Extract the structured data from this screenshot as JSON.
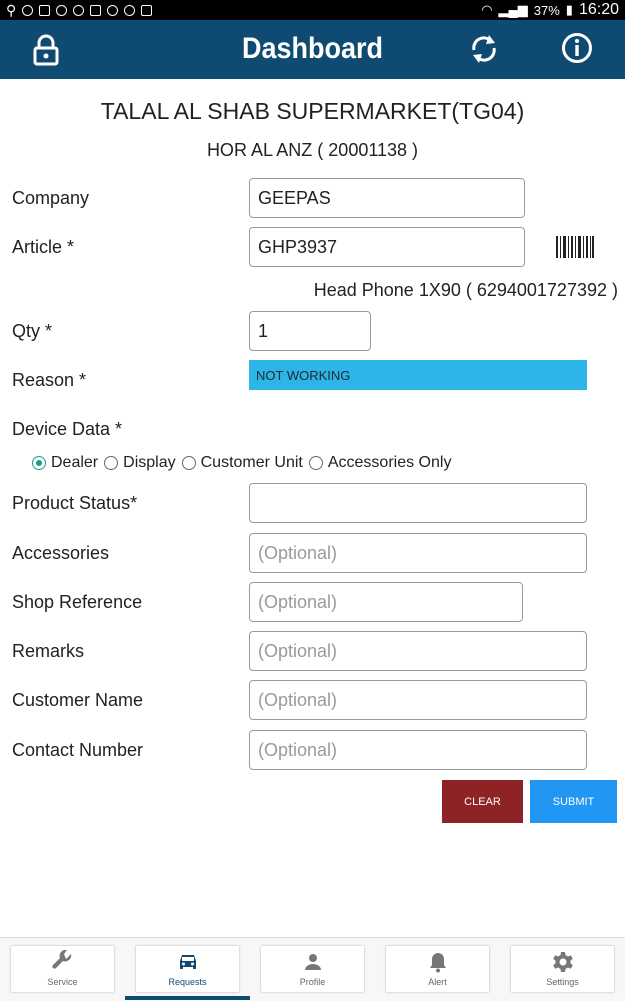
{
  "status_bar": {
    "battery": "37%",
    "time": "16:20"
  },
  "app_bar": {
    "title": "Dashboard"
  },
  "store": {
    "name": "TALAL AL SHAB SUPERMARKET(TG04)",
    "location": "HOR AL ANZ ( 20001138 )"
  },
  "form": {
    "company": {
      "label": "Company",
      "value": "GEEPAS"
    },
    "article": {
      "label": "Article *",
      "value": "GHP3937",
      "description": "Head Phone 1X90 ( 6294001727392 )"
    },
    "qty": {
      "label": "Qty *",
      "value": "1"
    },
    "reason": {
      "label": "Reason *",
      "value": "NOT WORKING"
    },
    "device_data": {
      "label": "Device Data *",
      "options": [
        "Dealer",
        "Display",
        "Customer Unit",
        "Accessories Only"
      ],
      "selected": "Dealer"
    },
    "product_status": {
      "label": "Product Status*",
      "value": ""
    },
    "accessories": {
      "label": "Accessories",
      "placeholder": "(Optional)"
    },
    "shop_reference": {
      "label": "Shop Reference",
      "placeholder": "(Optional)"
    },
    "remarks": {
      "label": "Remarks",
      "placeholder": "(Optional)"
    },
    "customer_name": {
      "label": "Customer Name",
      "placeholder": "(Optional)"
    },
    "contact_number": {
      "label": "Contact Number",
      "placeholder": "(Optional)"
    }
  },
  "buttons": {
    "clear": "CLEAR",
    "submit": "SUBMIT"
  },
  "bottom_nav": {
    "items": [
      {
        "label": "Service",
        "icon": "wrench-icon"
      },
      {
        "label": "Requests",
        "icon": "car-icon"
      },
      {
        "label": "Profile",
        "icon": "person-icon"
      },
      {
        "label": "Alert",
        "icon": "bell-icon"
      },
      {
        "label": "Settings",
        "icon": "gear-icon"
      }
    ],
    "active": "Requests"
  },
  "colors": {
    "app_bar": "#0f4a73",
    "reason_bg": "#2eb5e8",
    "clear_button": "#8e2326",
    "submit_button": "#2196f3",
    "radio_selected": "#17a085"
  }
}
